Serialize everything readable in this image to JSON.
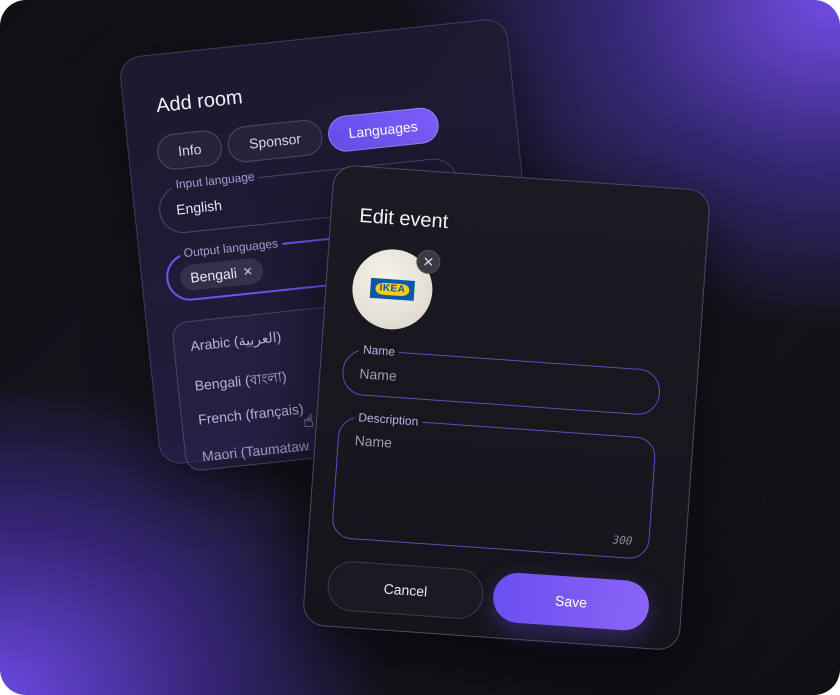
{
  "add_room": {
    "title": "Add room",
    "tabs": [
      {
        "label": "Info"
      },
      {
        "label": "Sponsor"
      },
      {
        "label": "Languages",
        "active": true
      }
    ],
    "input_language": {
      "label": "Input language",
      "value": "English"
    },
    "output_languages": {
      "label": "Output languages",
      "chips": [
        {
          "label": "Bengali",
          "remove_icon": "close-icon"
        }
      ]
    },
    "options": [
      "Arabic (العربية)",
      "Bengali (বাংলা)",
      "French (français)",
      "Maori (Taumataw"
    ]
  },
  "edit_event": {
    "title": "Edit event",
    "logo_text": "IKEA",
    "name_field": {
      "label": "Name",
      "placeholder": "Name"
    },
    "description_field": {
      "label": "Description",
      "placeholder": "Name",
      "counter": "300"
    },
    "cancel_label": "Cancel",
    "save_label": "Save"
  },
  "colors": {
    "accent": "#6b4ff0",
    "card_bg": "#1b1a22",
    "ikea_blue": "#0b58a8",
    "ikea_yellow": "#f9cc1a"
  }
}
